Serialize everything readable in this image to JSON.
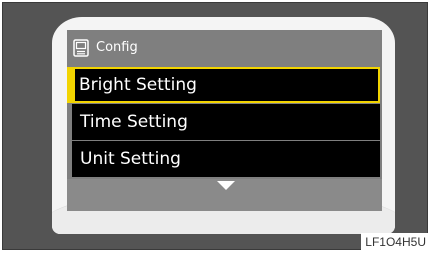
{
  "header": {
    "title": "Config",
    "icon": "config-display-icon"
  },
  "menu": {
    "items": [
      {
        "label": "Bright Setting",
        "selected": true
      },
      {
        "label": "Time Setting",
        "selected": false
      },
      {
        "label": "Unit Setting",
        "selected": false
      }
    ]
  },
  "scroll": {
    "icon": "down-arrow-icon"
  },
  "figure_code": "LF1O4H5U",
  "colors": {
    "highlight": "#f2d400",
    "screen_bg": "#7f7f7f",
    "item_bg": "#000000",
    "frame_bg": "#545454"
  }
}
